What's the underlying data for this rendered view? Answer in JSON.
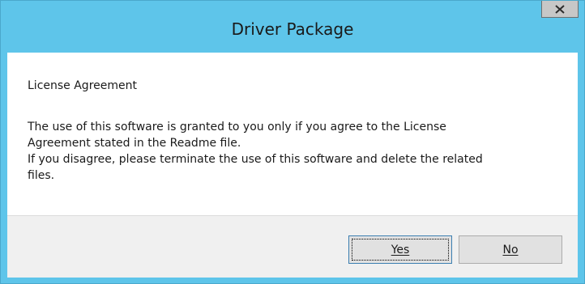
{
  "window": {
    "title": "Driver Package",
    "close_icon": "close-x-icon"
  },
  "content": {
    "heading": "License Agreement",
    "lines": [
      "The use of this software is granted to you only if you agree to the License",
      "Agreement stated in the Readme file.",
      "If you disagree, please terminate the use of this software and delete the related",
      "files."
    ]
  },
  "buttons": {
    "yes_label": "Yes",
    "no_label": "No"
  },
  "colors": {
    "titlebar": "#5ec5ea",
    "footer": "#f0f0f0",
    "button": "#e1e1e1"
  }
}
